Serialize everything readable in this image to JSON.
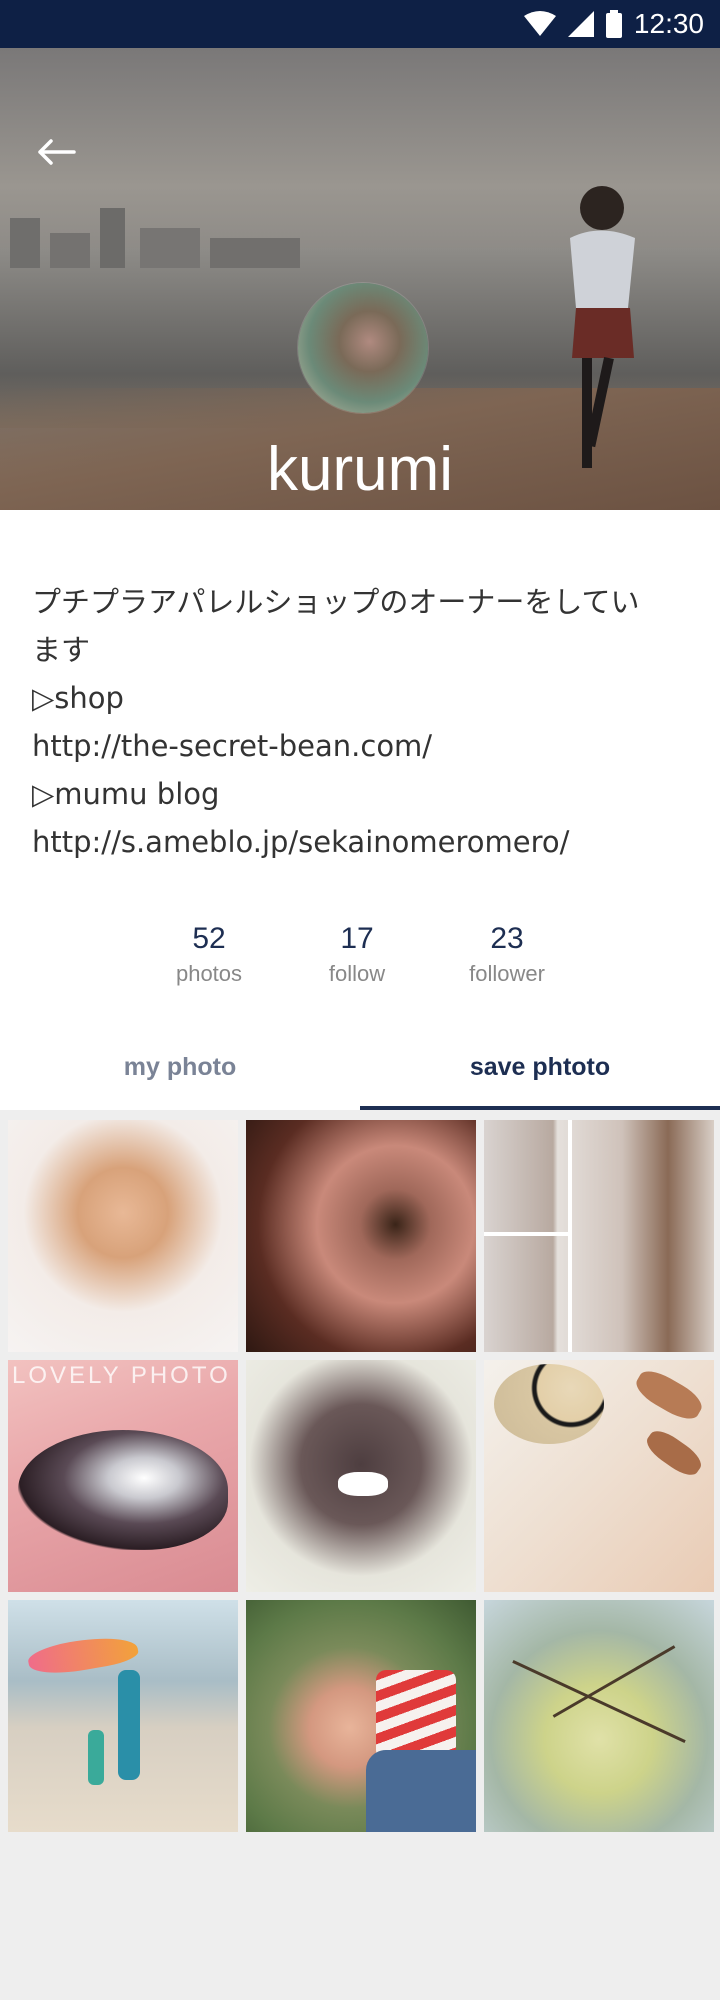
{
  "status_bar": {
    "time": "12:30",
    "icons": [
      "wifi-icon",
      "cellular-signal-icon",
      "battery-icon"
    ],
    "background": "#0e2045"
  },
  "header": {
    "username": "kurumi",
    "back_icon": "arrow-left-icon"
  },
  "bio": {
    "lines": [
      "プチプラアパレルショップのオーナーをしてい",
      "ます",
      "▷shop",
      "http://the-secret-bean.com/",
      "▷mumu blog",
      "http://s.ameblo.jp/sekainomeromero/"
    ]
  },
  "stats": [
    {
      "value": "52",
      "label": "photos"
    },
    {
      "value": "17",
      "label": "follow"
    },
    {
      "value": "23",
      "label": "follower"
    }
  ],
  "tabs": [
    {
      "label": "my photo",
      "active": false
    },
    {
      "label": "save phtoto",
      "active": true
    }
  ],
  "grid": {
    "tiles": [
      {
        "subject": "short-hair-portrait"
      },
      {
        "subject": "eye-closeup"
      },
      {
        "subject": "long-hair-collage"
      },
      {
        "subject": "glitter-eye-makeup",
        "text": "LOVELY PHOTO"
      },
      {
        "subject": "hair-bow"
      },
      {
        "subject": "hat-and-sandals"
      },
      {
        "subject": "beach-family"
      },
      {
        "subject": "child-on-grass"
      },
      {
        "subject": "blossom-branches"
      }
    ]
  },
  "colors": {
    "accent": "#1d2e52",
    "inactive_tab": "#7a8396",
    "background": "#eeeeee"
  }
}
